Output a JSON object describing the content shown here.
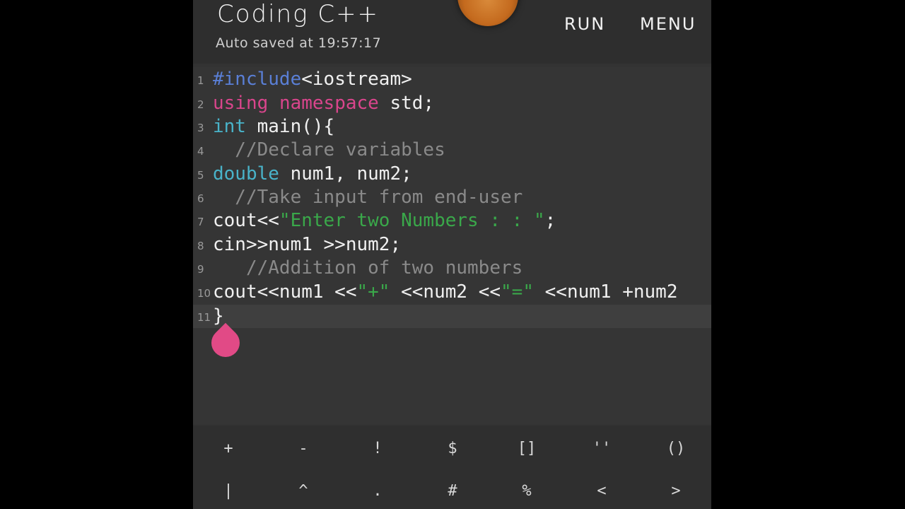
{
  "header": {
    "title": "Coding C++",
    "autosave": "Auto saved at 19:57:17",
    "run_label": "RUN",
    "menu_label": "MENU"
  },
  "editor": {
    "lines": [
      {
        "n": "1",
        "tokens": [
          {
            "t": "#include",
            "c": "kw-pre"
          },
          {
            "t": "<iostream>",
            "c": ""
          }
        ]
      },
      {
        "n": "2",
        "tokens": [
          {
            "t": "using",
            "c": "kw"
          },
          {
            "t": " ",
            "c": ""
          },
          {
            "t": "namespace",
            "c": "kw"
          },
          {
            "t": " std;",
            "c": ""
          }
        ]
      },
      {
        "n": "3",
        "tokens": [
          {
            "t": "int",
            "c": "ty"
          },
          {
            "t": " main(){",
            "c": ""
          }
        ]
      },
      {
        "n": "4",
        "tokens": [
          {
            "t": "  //Declare variables",
            "c": "cm"
          }
        ]
      },
      {
        "n": "5",
        "tokens": [
          {
            "t": "double",
            "c": "ty"
          },
          {
            "t": " num1, num2;",
            "c": ""
          }
        ]
      },
      {
        "n": "6",
        "tokens": [
          {
            "t": "  //Take input from end-user",
            "c": "cm"
          }
        ]
      },
      {
        "n": "7",
        "tokens": [
          {
            "t": "cout<<",
            "c": ""
          },
          {
            "t": "\"Enter two Numbers : : \"",
            "c": "st"
          },
          {
            "t": ";",
            "c": ""
          }
        ]
      },
      {
        "n": "8",
        "tokens": [
          {
            "t": "cin>>num1 >>num2;",
            "c": ""
          }
        ]
      },
      {
        "n": "9",
        "tokens": [
          {
            "t": "   //Addition of two numbers",
            "c": "cm"
          }
        ]
      },
      {
        "n": "10",
        "tokens": [
          {
            "t": "cout<<num1 <<",
            "c": ""
          },
          {
            "t": "\"+\"",
            "c": "st"
          },
          {
            "t": " <<num2 <<",
            "c": ""
          },
          {
            "t": "\"=\"",
            "c": "st"
          },
          {
            "t": " <<num1 +num2",
            "c": ""
          }
        ]
      },
      {
        "n": "11",
        "tokens": [
          {
            "t": "}",
            "c": ""
          }
        ]
      }
    ]
  },
  "keyboard": {
    "row1": [
      "+",
      "-",
      "!",
      "$",
      "[]",
      "''",
      "()"
    ],
    "row2": [
      "|",
      "^",
      ".",
      "#",
      "%",
      "<",
      ">"
    ]
  }
}
